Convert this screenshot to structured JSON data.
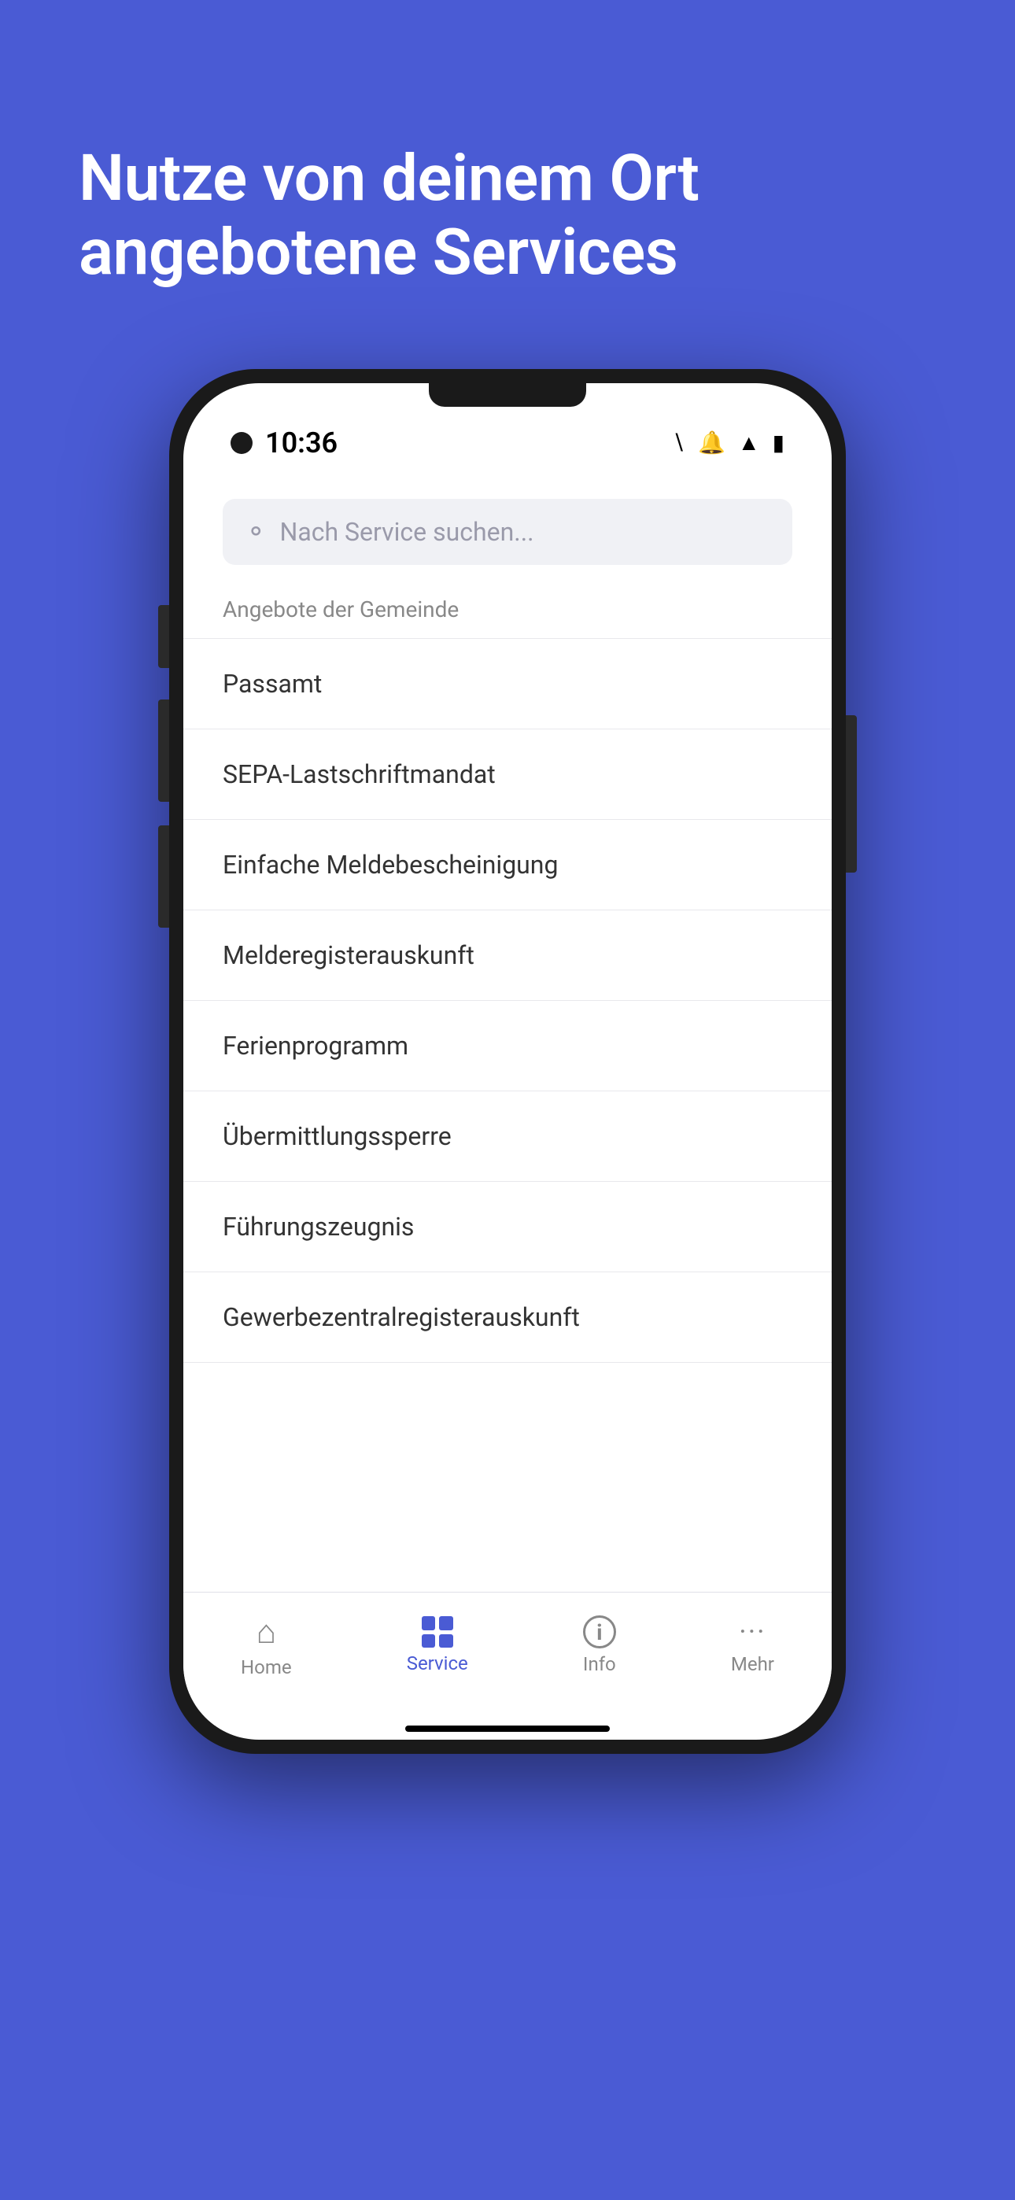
{
  "background": {
    "color": "#4A5BD4"
  },
  "hero": {
    "title": "Nutze von deinem Ort angebotene Services"
  },
  "phone": {
    "status_bar": {
      "time": "10:36",
      "icons": [
        "bluetooth",
        "mute",
        "wifi",
        "battery"
      ]
    },
    "search": {
      "placeholder": "Nach Service suchen..."
    },
    "section_label": "Angebote der Gemeinde",
    "service_items": [
      {
        "label": "Passamt"
      },
      {
        "label": "SEPA-Lastschriftmandat"
      },
      {
        "label": "Einfache Meldebescheinigung"
      },
      {
        "label": "Melderegisterauskunft"
      },
      {
        "label": "Ferienprogramm"
      },
      {
        "label": "Übermittlungssperre"
      },
      {
        "label": "Führungszeugnis"
      },
      {
        "label": "Gewerbezentralregisterauskunft"
      }
    ],
    "bottom_nav": [
      {
        "id": "home",
        "label": "Home",
        "active": false
      },
      {
        "id": "service",
        "label": "Service",
        "active": true
      },
      {
        "id": "info",
        "label": "Info",
        "active": false
      },
      {
        "id": "mehr",
        "label": "Mehr",
        "active": false
      }
    ]
  }
}
